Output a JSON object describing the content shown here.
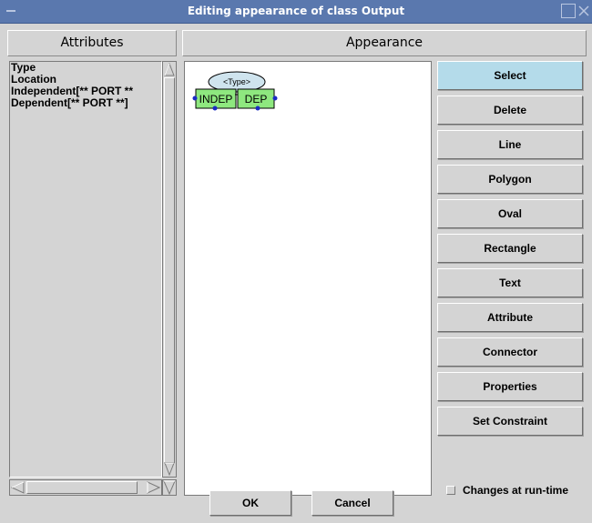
{
  "window": {
    "title": "Editing appearance of class Output",
    "titlebar_color": "#5a78ae",
    "icons": [
      "menu-icon",
      "maximize-icon",
      "close-icon"
    ]
  },
  "headers": {
    "attributes": "Attributes",
    "appearance": "Appearance"
  },
  "attributes": {
    "items": [
      "Type",
      "Location",
      "Independent[** PORT **",
      "Dependent[** PORT **]"
    ]
  },
  "canvas": {
    "type_label": "<Type>",
    "port_independent": "INDEP",
    "port_dependent": "DEP",
    "shape_fill": "#cfe4ee",
    "port_fill": "#8ee87f",
    "connector_color": "#1a2bc4"
  },
  "toolbar": {
    "selected": "Select",
    "active_color": "#b4dbea",
    "buttons": [
      "Select",
      "Delete",
      "Line",
      "Polygon",
      "Oval",
      "Rectangle",
      "Text",
      "Attribute",
      "Connector",
      "Properties",
      "Set Constraint"
    ]
  },
  "options": {
    "changes_at_runtime_label": "Changes at run-time",
    "changes_at_runtime_checked": false
  },
  "dialog": {
    "ok_label": "OK",
    "cancel_label": "Cancel"
  }
}
